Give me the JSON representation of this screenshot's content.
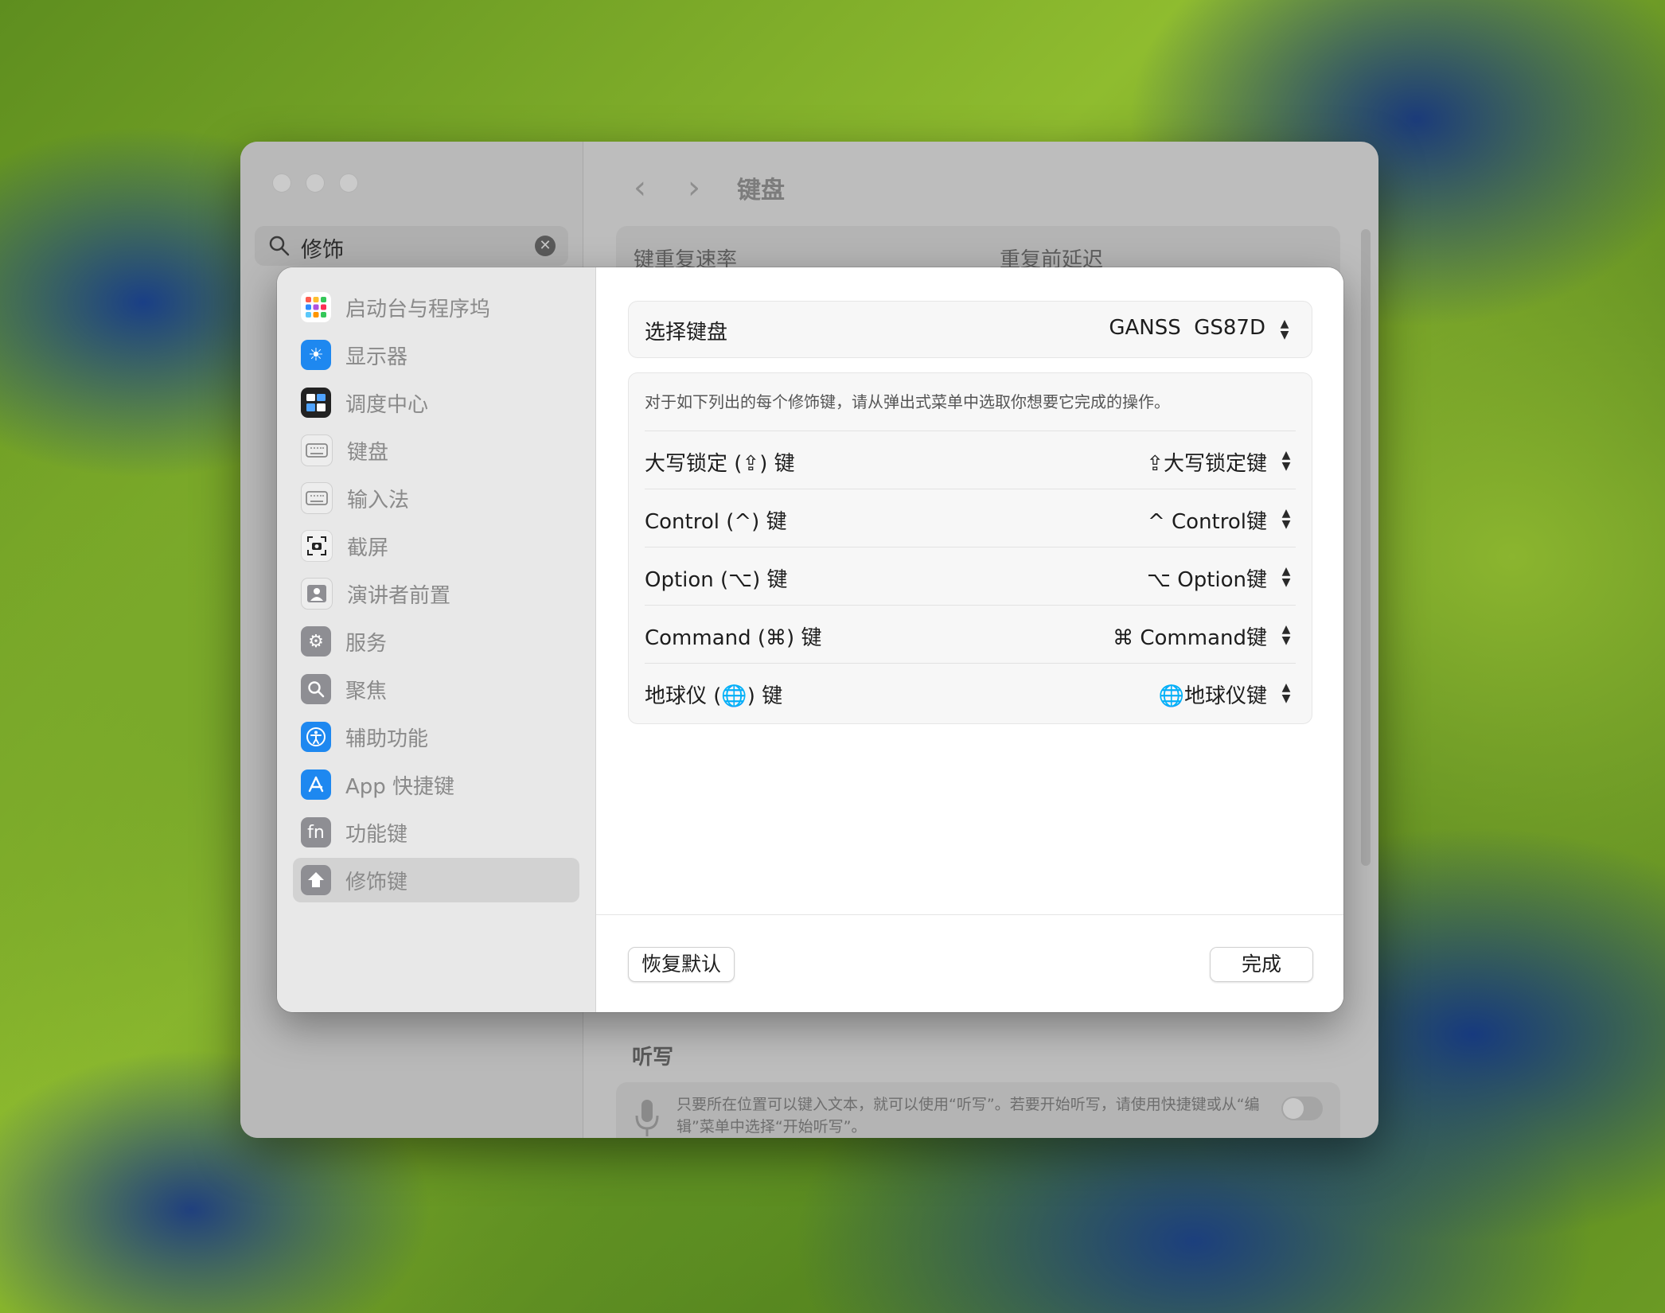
{
  "window": {
    "title": "键盘",
    "search_value": "修饰",
    "top_labels": [
      "键重复速率",
      "重复前延迟"
    ],
    "dictation_title": "听写",
    "dictation_desc": "只要所在位置可以键入文本，就可以使用“听写”。若要开始听写，请使用快捷键或从“编辑”菜单中选择“开始听写”。"
  },
  "sidebar": {
    "items": [
      {
        "label": "启动台与程序坞",
        "icon": "launchpad-icon",
        "color": "#ffffff"
      },
      {
        "label": "显示器",
        "icon": "display-icon",
        "color": "#1e88f0"
      },
      {
        "label": "调度中心",
        "icon": "mission-control-icon",
        "color": "#222222"
      },
      {
        "label": "键盘",
        "icon": "keyboard-icon",
        "color": "#8e8e93"
      },
      {
        "label": "输入法",
        "icon": "keyboard-icon",
        "color": "#8e8e93"
      },
      {
        "label": "截屏",
        "icon": "screenshot-icon",
        "color": "#f2f2f2"
      },
      {
        "label": "演讲者前置",
        "icon": "presenter-icon",
        "color": "#8e8e93"
      },
      {
        "label": "服务",
        "icon": "gear-icon",
        "color": "#8e8e93"
      },
      {
        "label": "聚焦",
        "icon": "search-icon",
        "color": "#8e8e93"
      },
      {
        "label": "辅助功能",
        "icon": "accessibility-icon",
        "color": "#1e88f0"
      },
      {
        "label": "App 快捷键",
        "icon": "app-store-icon",
        "color": "#1e88f0"
      },
      {
        "label": "功能键",
        "icon": "fn-icon",
        "color": "#8e8e93"
      },
      {
        "label": "修饰键",
        "icon": "modifier-icon",
        "color": "#8e8e93"
      }
    ]
  },
  "keyboard_select": {
    "label": "选择键盘",
    "value": "GANSS  GS87D"
  },
  "modifiers": {
    "description": "对于如下列出的每个修饰键，请从弹出式菜单中选取你想要它完成的操作。",
    "rows": [
      {
        "label": "大写锁定 (⇪) 键",
        "value": "⇪大写锁定键"
      },
      {
        "label": "Control (^) 键",
        "value": "^ Control键"
      },
      {
        "label": "Option (⌥) 键",
        "value": "⌥ Option键"
      },
      {
        "label": "Command (⌘) 键",
        "value": "⌘ Command键"
      },
      {
        "label": "地球仪 (🌐) 键",
        "value": "🌐地球仪键"
      }
    ]
  },
  "footer": {
    "restore_label": "恢复默认",
    "done_label": "完成"
  }
}
